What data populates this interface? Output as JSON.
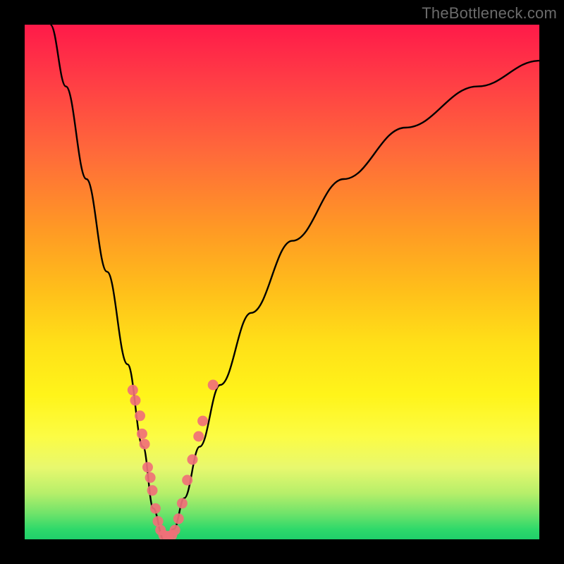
{
  "watermark": "TheBottleneck.com",
  "chart_data": {
    "type": "line",
    "title": "",
    "xlabel": "",
    "ylabel": "",
    "xlim": [
      0,
      100
    ],
    "ylim": [
      0,
      100
    ],
    "background_gradient": {
      "top_color": "#ff1a49",
      "mid_color": "#ffe018",
      "bottom_color": "#1fd06a",
      "meaning": "bottleneck severity, red=high, green=low"
    },
    "series": [
      {
        "name": "bottleneck-curve",
        "description": "V-shaped curve, two branches meeting at an optimum near x≈27",
        "x": [
          5,
          8,
          12,
          16,
          20,
          23,
          25,
          27,
          29,
          31,
          34,
          38,
          44,
          52,
          62,
          74,
          88,
          100
        ],
        "values": [
          100,
          88,
          70,
          52,
          34,
          18,
          6,
          0,
          2,
          8,
          18,
          30,
          44,
          58,
          70,
          80,
          88,
          93
        ]
      }
    ],
    "markers": {
      "name": "sample-points",
      "color": "#f07078",
      "description": "clustered pink dots near the curve minimum on both branches",
      "points": [
        {
          "x": 21.0,
          "y": 29.0
        },
        {
          "x": 21.5,
          "y": 27.0
        },
        {
          "x": 22.4,
          "y": 24.0
        },
        {
          "x": 22.8,
          "y": 20.5
        },
        {
          "x": 23.3,
          "y": 18.5
        },
        {
          "x": 23.9,
          "y": 14.0
        },
        {
          "x": 24.4,
          "y": 12.0
        },
        {
          "x": 24.8,
          "y": 9.5
        },
        {
          "x": 25.4,
          "y": 6.0
        },
        {
          "x": 25.9,
          "y": 3.5
        },
        {
          "x": 26.4,
          "y": 1.8
        },
        {
          "x": 27.0,
          "y": 0.8
        },
        {
          "x": 27.8,
          "y": 0.6
        },
        {
          "x": 28.6,
          "y": 0.8
        },
        {
          "x": 29.2,
          "y": 1.8
        },
        {
          "x": 29.9,
          "y": 4.0
        },
        {
          "x": 30.6,
          "y": 7.0
        },
        {
          "x": 31.6,
          "y": 11.5
        },
        {
          "x": 32.6,
          "y": 15.5
        },
        {
          "x": 33.8,
          "y": 20.0
        },
        {
          "x": 34.6,
          "y": 23.0
        },
        {
          "x": 36.6,
          "y": 30.0
        }
      ]
    }
  }
}
